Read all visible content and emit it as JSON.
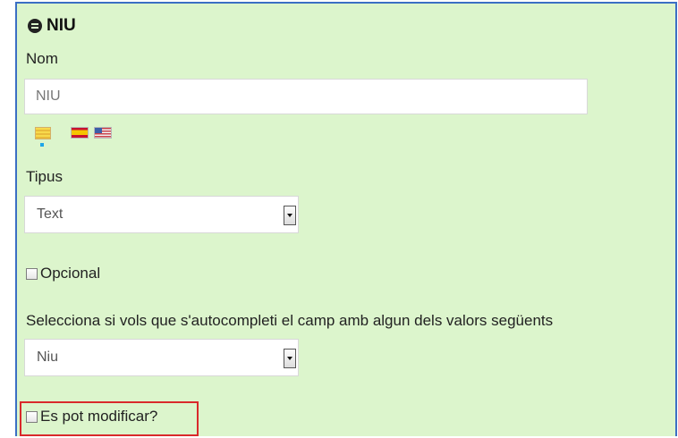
{
  "section": {
    "title": "NIU",
    "title_icon": "list-icon"
  },
  "name_field": {
    "label": "Nom",
    "value": "NIU",
    "languages": [
      "ca-flag-icon",
      "es-flag-icon",
      "us-flag-icon"
    ]
  },
  "type_field": {
    "label": "Tipus",
    "selected": "Text"
  },
  "optional": {
    "label": "Opcional",
    "checked": false
  },
  "autocomplete": {
    "label": "Selecciona si vols que s'autocompleti el camp amb algun dels valors següents",
    "selected": "Niu"
  },
  "modifiable": {
    "label": "Es pot modificar?",
    "checked": false,
    "highlight_color": "#d9292b"
  },
  "colors": {
    "panel_bg": "#dcf5cc",
    "panel_border": "#3b6fc4"
  }
}
